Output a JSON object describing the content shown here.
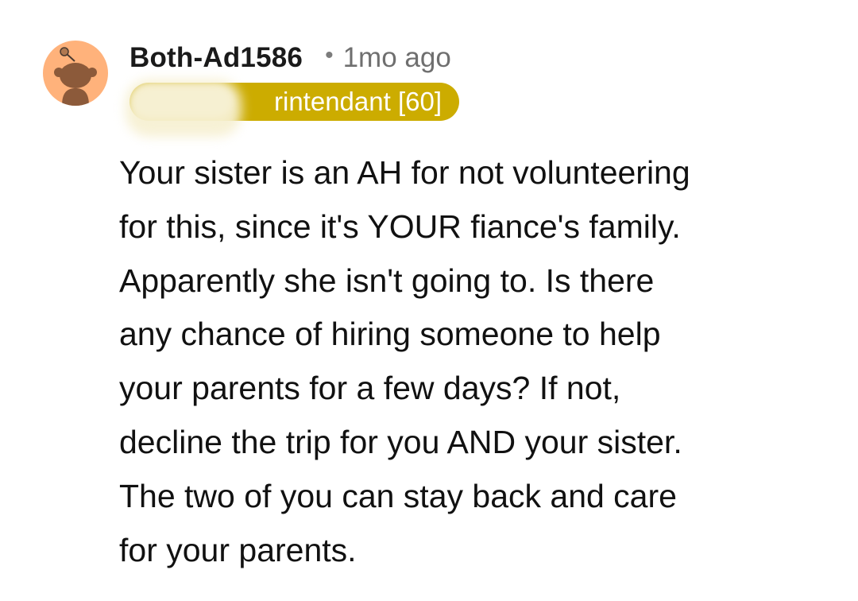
{
  "comment": {
    "avatar_icon": "reddit-snoo-avatar-icon",
    "avatar_color": "#ffb27b",
    "username": "Both-Ad1586",
    "separator": "•",
    "timestamp": "1mo ago",
    "flair": {
      "text": "rintendant [60]",
      "color": "#ccac00",
      "partially_obscured": true
    },
    "body": "Your sister is an AH for not volunteering\nfor this, since it's YOUR fiance's family.\nApparently she isn't going to.  Is there\nany chance of hiring someone to help\nyour parents for a few days?  If not,\ndecline the trip for you AND your sister.\nThe two of you can stay back and care\nfor your parents."
  }
}
